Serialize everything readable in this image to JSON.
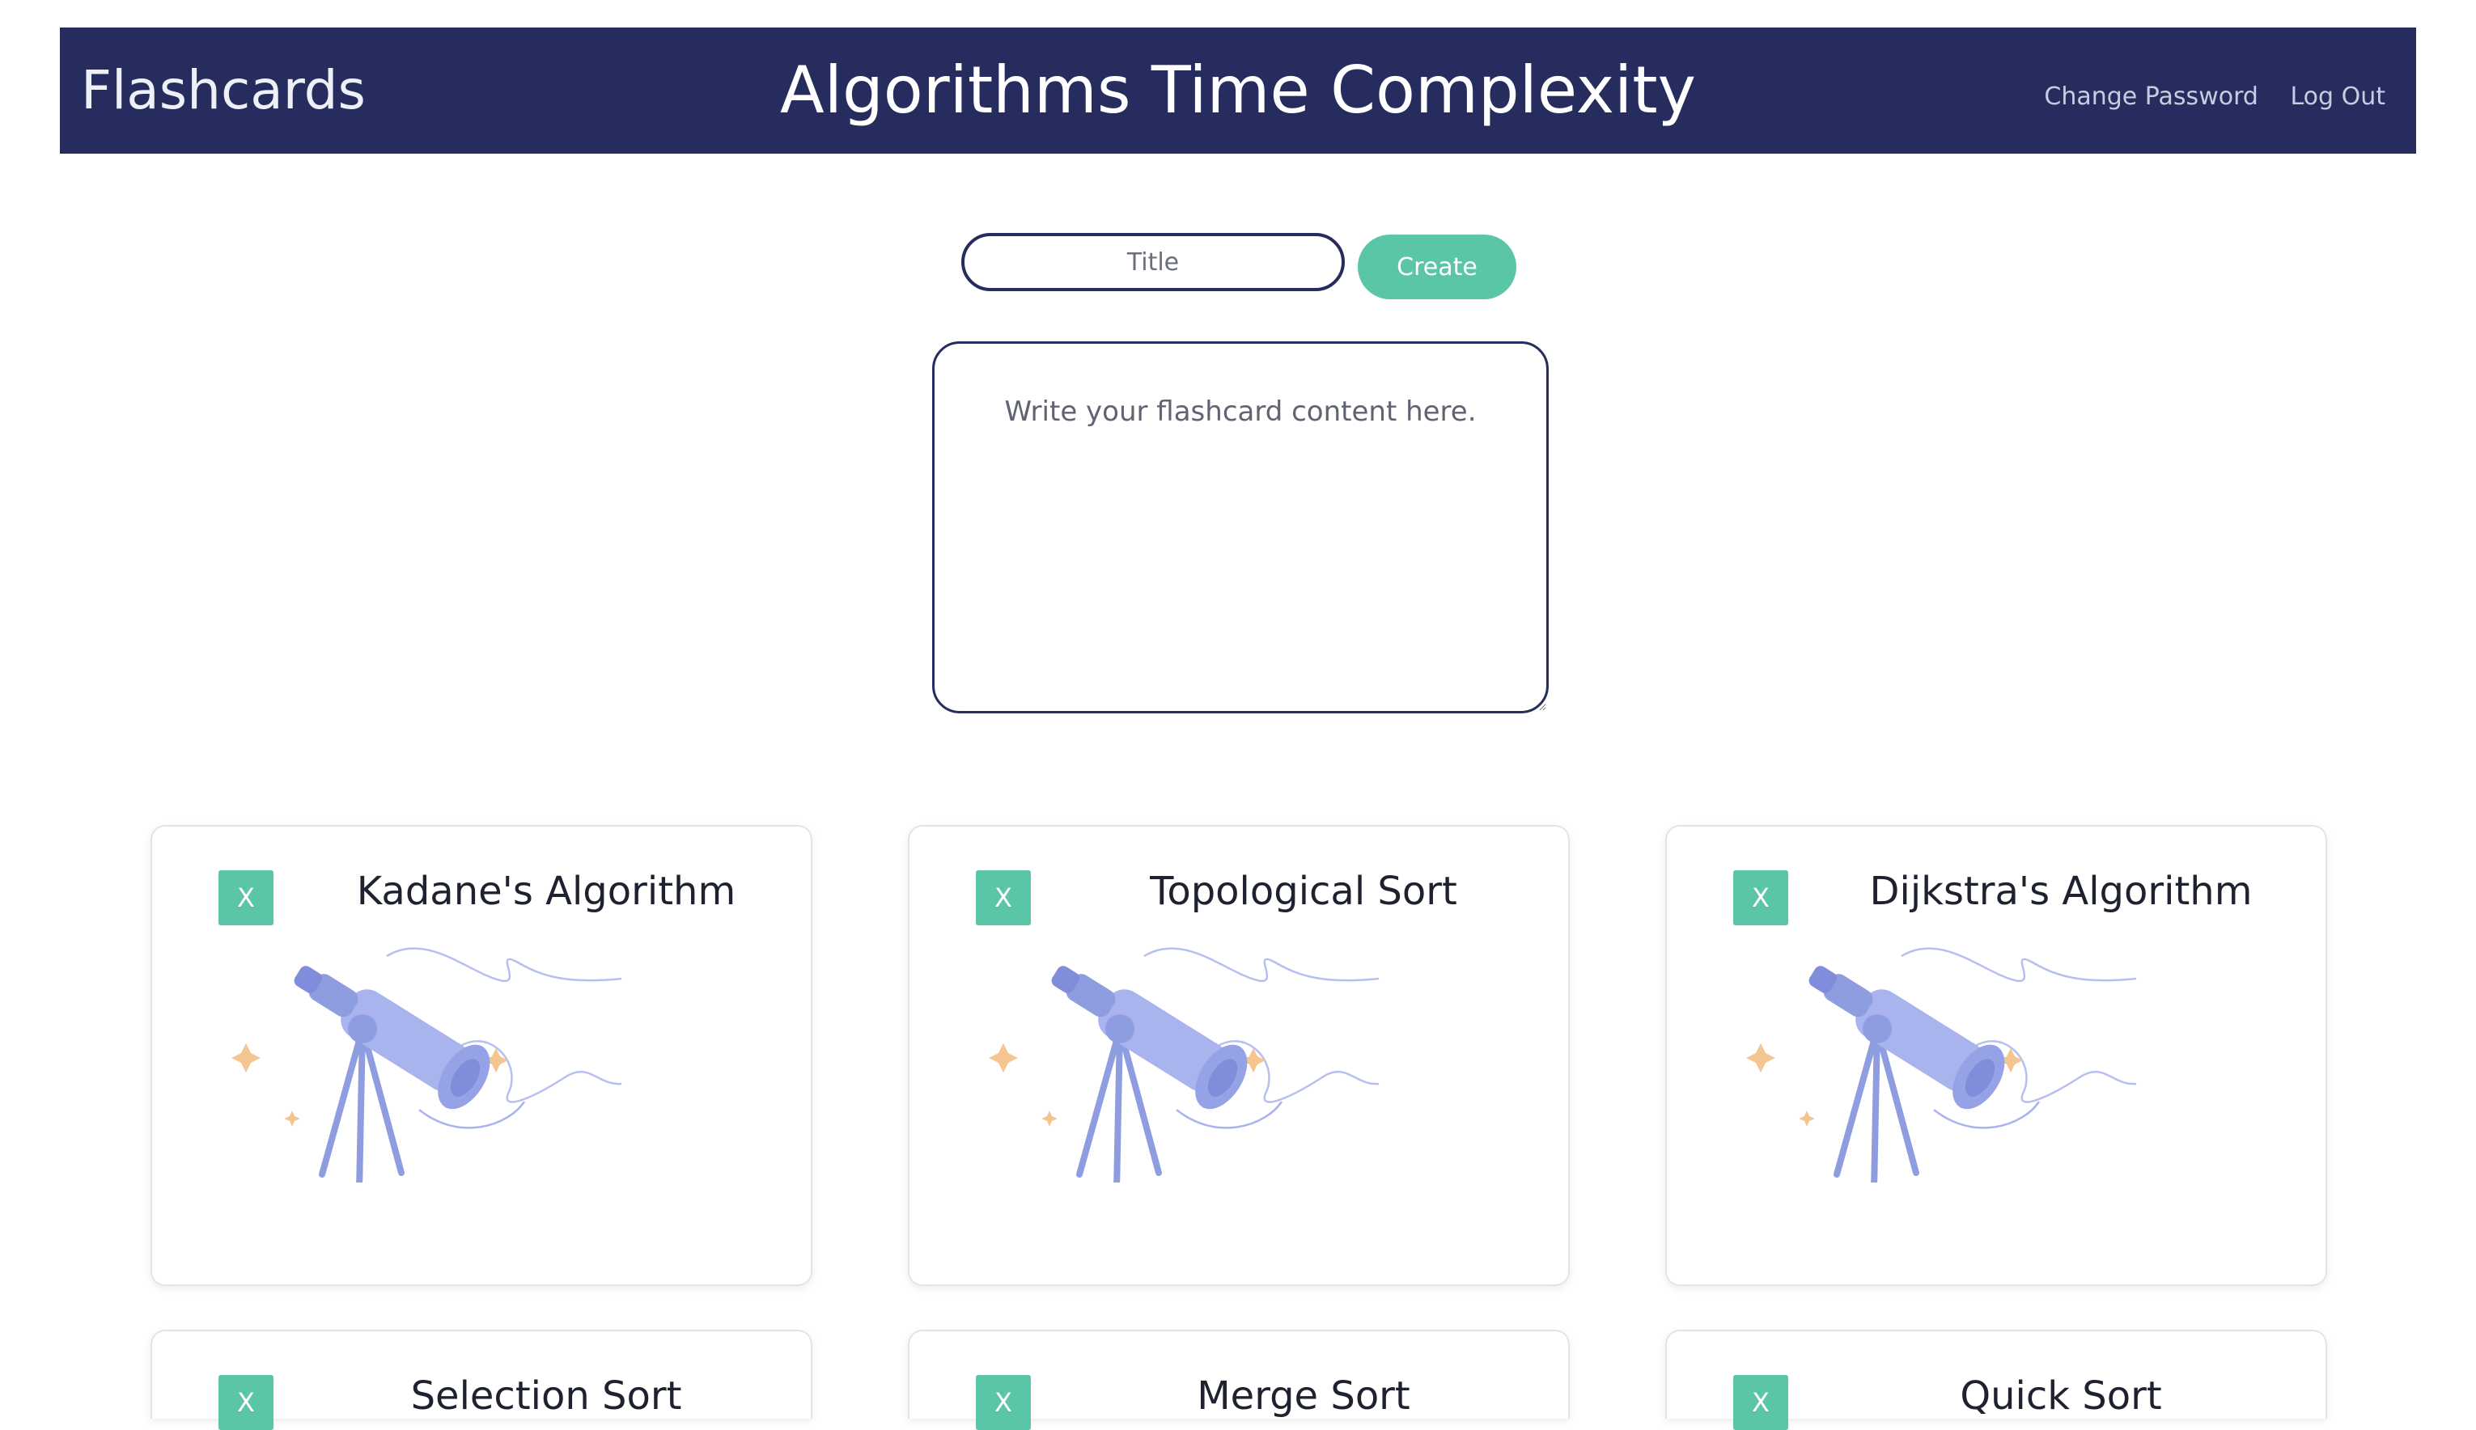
{
  "navbar": {
    "brand": "Flashcards",
    "title": "Algorithms Time Complexity",
    "links": [
      "Change Password",
      "Log Out"
    ],
    "background": "#262c5e"
  },
  "form": {
    "title_placeholder": "Title",
    "title_value": "",
    "create_label": "Create",
    "content_placeholder": "Write your flashcard content here.",
    "content_value": "",
    "accent": "#5bc5a7"
  },
  "cards": [
    {
      "title": "Kadane's Algorithm",
      "delete_label": "X",
      "image": "telescope-illustration"
    },
    {
      "title": "Topological Sort",
      "delete_label": "X",
      "image": "telescope-illustration"
    },
    {
      "title": "Dijkstra's Algorithm",
      "delete_label": "X",
      "image": "telescope-illustration"
    },
    {
      "title": "Selection Sort",
      "delete_label": "X",
      "image": "telescope-illustration"
    },
    {
      "title": "Merge Sort",
      "delete_label": "X",
      "image": "telescope-illustration"
    },
    {
      "title": "Quick Sort",
      "delete_label": "X",
      "image": "telescope-illustration"
    }
  ]
}
